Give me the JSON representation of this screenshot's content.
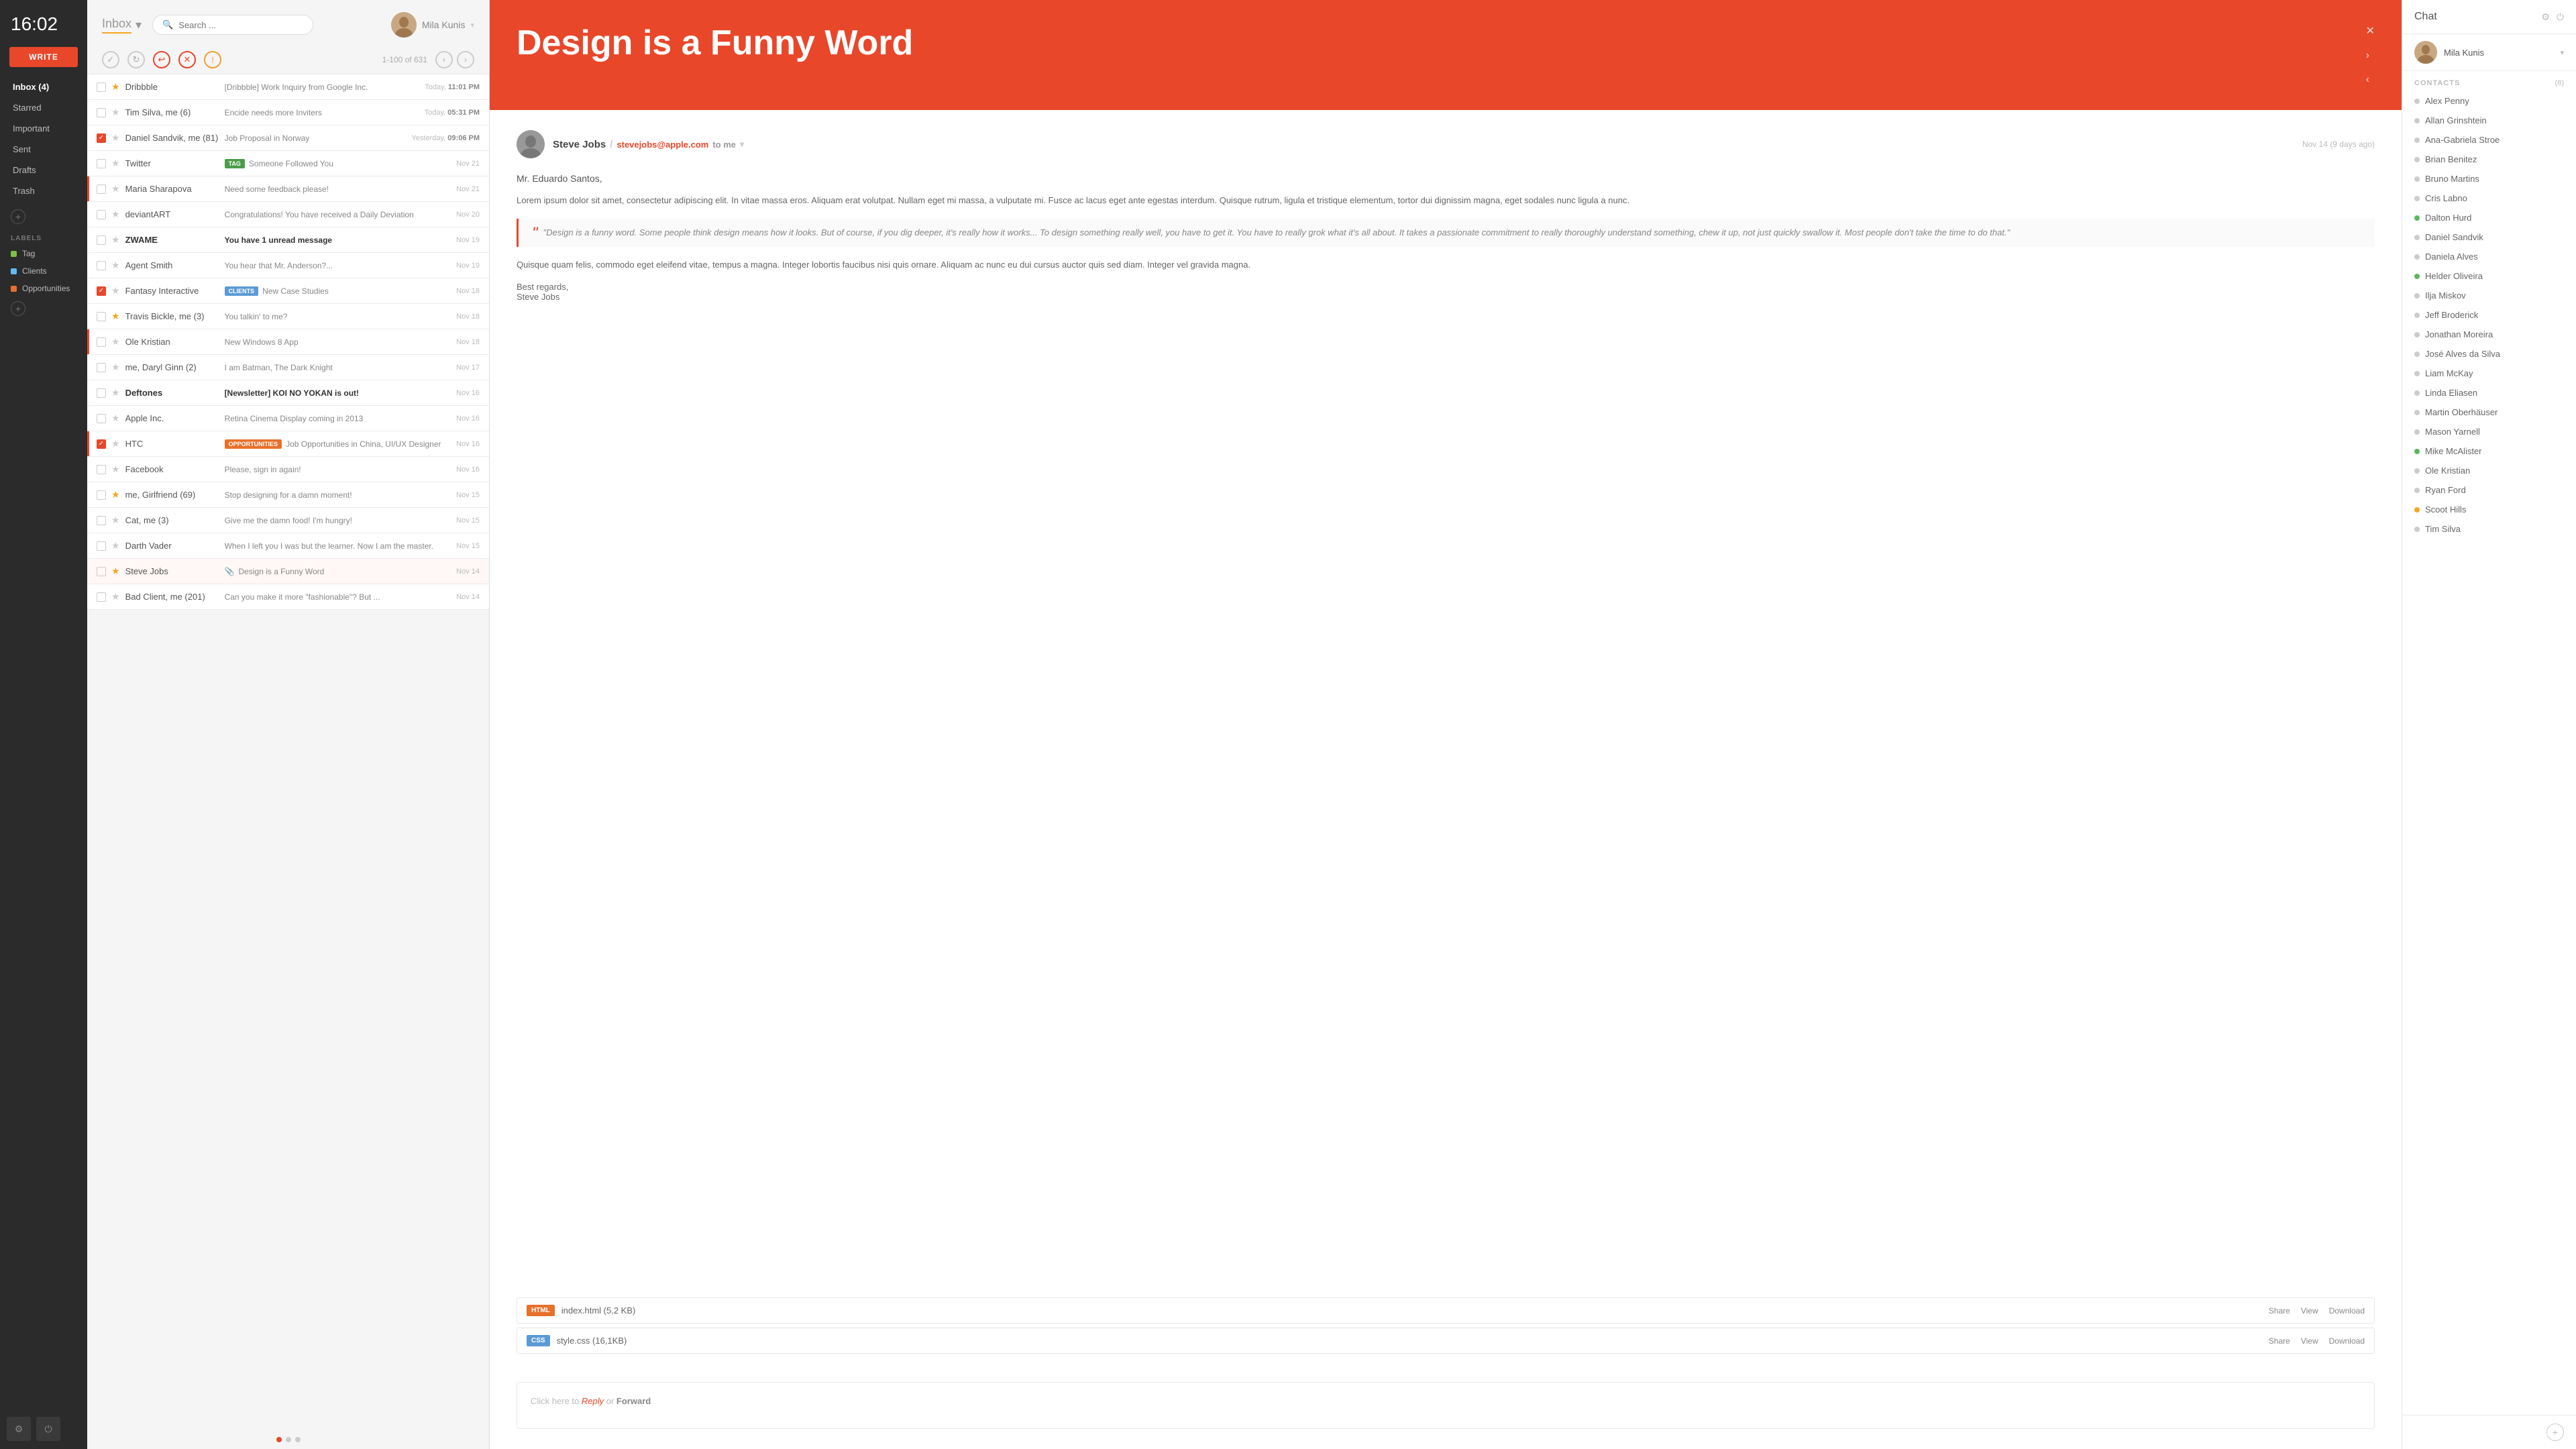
{
  "time": "16:02",
  "write_btn": "WRITE",
  "sidebar": {
    "nav": [
      {
        "id": "inbox",
        "label": "Inbox (4)",
        "active": true
      },
      {
        "id": "starred",
        "label": "Starred"
      },
      {
        "id": "important",
        "label": "Important"
      },
      {
        "id": "sent",
        "label": "Sent"
      },
      {
        "id": "drafts",
        "label": "Drafts"
      },
      {
        "id": "trash",
        "label": "Trash"
      }
    ],
    "labels_header": "LABELS",
    "labels": [
      {
        "id": "tag",
        "label": "Tag",
        "color": "#7dc242"
      },
      {
        "id": "clients",
        "label": "Clients",
        "color": "#5bbcf8"
      },
      {
        "id": "opportunities",
        "label": "Opportunities",
        "color": "#e8702a"
      }
    ]
  },
  "inbox": {
    "title": "Inbox",
    "dropdown_icon": "▾",
    "search_placeholder": "Search ...",
    "user_name": "Mila Kunis",
    "page_info": "1-100 of 631"
  },
  "emails": [
    {
      "id": 1,
      "sender": "Dribbble",
      "subject": "[Dribbble] Work Inquiry from Google Inc.",
      "date": "Today,",
      "time": "11:01 PM",
      "starred": true,
      "unread": false,
      "checked": false,
      "urgent": false,
      "tag": null
    },
    {
      "id": 2,
      "sender": "Tim Silva, me (6)",
      "subject": "Encide needs more Inviters",
      "date": "Today,",
      "time": "05:31 PM",
      "starred": false,
      "unread": false,
      "checked": false,
      "urgent": false,
      "tag": null
    },
    {
      "id": 3,
      "sender": "Daniel Sandvik, me (81)",
      "subject": "Job Proposal in Norway",
      "date": "Yesterday,",
      "time": "09:06 PM",
      "starred": false,
      "unread": false,
      "checked": true,
      "urgent": false,
      "tag": null
    },
    {
      "id": 4,
      "sender": "Twitter",
      "subject": "Someone Followed You",
      "date": "Nov 21",
      "time": "",
      "starred": false,
      "unread": false,
      "checked": false,
      "urgent": false,
      "tag": "TAG"
    },
    {
      "id": 5,
      "sender": "Maria Sharapova",
      "subject": "Need some feedback please!",
      "date": "Nov 21",
      "time": "",
      "starred": false,
      "unread": false,
      "checked": false,
      "urgent": true,
      "tag": null
    },
    {
      "id": 6,
      "sender": "deviantART",
      "subject": "Congratulations! You have received a Daily Deviation",
      "date": "Nov 20",
      "time": "",
      "starred": false,
      "unread": false,
      "checked": false,
      "urgent": false,
      "tag": null
    },
    {
      "id": 7,
      "sender": "ZWAME",
      "subject": "You have 1 unread message",
      "date": "Nov 19",
      "time": "",
      "starred": false,
      "unread": true,
      "checked": false,
      "urgent": false,
      "tag": null
    },
    {
      "id": 8,
      "sender": "Agent Smith",
      "subject": "You hear that Mr. Anderson?...",
      "date": "Nov 19",
      "time": "",
      "starred": false,
      "unread": false,
      "checked": false,
      "urgent": false,
      "tag": null
    },
    {
      "id": 9,
      "sender": "Fantasy Interactive",
      "subject": "New Case Studies",
      "date": "Nov 18",
      "time": "",
      "starred": false,
      "unread": false,
      "checked": true,
      "urgent": false,
      "tag": "CLIENTS"
    },
    {
      "id": 10,
      "sender": "Travis Bickle, me (3)",
      "subject": "You talkin' to me?",
      "date": "Nov 18",
      "time": "",
      "starred": true,
      "unread": false,
      "checked": false,
      "urgent": false,
      "tag": null
    },
    {
      "id": 11,
      "sender": "Ole Kristian",
      "subject": "New Windows 8 App",
      "date": "Nov 18",
      "time": "",
      "starred": false,
      "unread": false,
      "checked": false,
      "urgent": true,
      "tag": null
    },
    {
      "id": 12,
      "sender": "me, Daryl Ginn (2)",
      "subject": "I am Batman, The Dark Knight",
      "date": "Nov 17",
      "time": "",
      "starred": false,
      "unread": false,
      "checked": false,
      "urgent": false,
      "tag": null
    },
    {
      "id": 13,
      "sender": "Deftones",
      "subject": "[Newsletter] KOI NO YOKAN is out!",
      "date": "Nov 16",
      "time": "",
      "starred": false,
      "unread": true,
      "checked": false,
      "urgent": false,
      "tag": null
    },
    {
      "id": 14,
      "sender": "Apple Inc.",
      "subject": "Retina Cinema Display coming in 2013",
      "date": "Nov 16",
      "time": "",
      "starred": false,
      "unread": false,
      "checked": false,
      "urgent": false,
      "tag": null
    },
    {
      "id": 15,
      "sender": "HTC",
      "subject": "Job Opportunities in China, UI/UX Designer",
      "date": "Nov 16",
      "time": "",
      "starred": false,
      "unread": false,
      "checked": true,
      "urgent": true,
      "tag": "OPPORTUNITIES"
    },
    {
      "id": 16,
      "sender": "Facebook",
      "subject": "Please, sign in again!",
      "date": "Nov 16",
      "time": "",
      "starred": false,
      "unread": false,
      "checked": false,
      "urgent": false,
      "tag": null
    },
    {
      "id": 17,
      "sender": "me, Girlfriend (69)",
      "subject": "Stop designing for a damn moment!",
      "date": "Nov 15",
      "time": "",
      "starred": true,
      "unread": false,
      "checked": false,
      "urgent": false,
      "tag": null
    },
    {
      "id": 18,
      "sender": "Cat, me (3)",
      "subject": "Give me the damn food! I'm hungry!",
      "date": "Nov 15",
      "time": "",
      "starred": false,
      "unread": false,
      "checked": false,
      "urgent": false,
      "tag": null
    },
    {
      "id": 19,
      "sender": "Darth Vader",
      "subject": "When I left you I was but the learner. Now I am the master.",
      "date": "Nov 15",
      "time": "",
      "starred": false,
      "unread": false,
      "checked": false,
      "urgent": false,
      "tag": null
    },
    {
      "id": 20,
      "sender": "Steve Jobs",
      "subject": "Design is a Funny Word",
      "date": "Nov 14",
      "time": "",
      "starred": true,
      "unread": false,
      "checked": false,
      "urgent": false,
      "tag": null,
      "active": true
    },
    {
      "id": 21,
      "sender": "Bad Client, me (201)",
      "subject": "Can you make it more \"fashionable\"? But ...",
      "date": "Nov 14",
      "time": "",
      "starred": false,
      "unread": false,
      "checked": false,
      "urgent": false,
      "tag": null
    }
  ],
  "email_detail": {
    "hero_title": "Design is a Funny Word",
    "sender_name": "Steve Jobs",
    "sender_email": "stevejobs@apple.com",
    "to_text": "to me",
    "timestamp": "Nov 14 (9 days ago)",
    "greeting": "Mr. Eduardo Santos,",
    "para1": "Lorem ipsum dolor sit amet, consectetur adipiscing elit. In vitae massa eros. Aliquam erat volutpat. Nullam eget mi massa, a vulputate mi. Fusce ac lacus eget ante egestas interdum. Quisque rutrum, ligula et tristique elementum, tortor dui dignissim magna, eget sodales nunc ligula a nunc.",
    "quote": "\"Design is a funny word. Some people think design means how it looks. But of course, if you dig deeper, it's really how it works... To design something really well, you have to get it. You have to really grok what it's all about. It takes a passionate commitment to really thoroughly understand something, chew it up, not just quickly swallow it. Most people don't take the time to do that.\"",
    "para2": "Quisque quam felis, commodo eget eleifend vitae, tempus a magna. Integer lobortis faucibus nisi quis ornare. Aliquam ac nunc eu dui cursus auctor quis sed diam. Integer vel gravida magna.",
    "signature": "Best regards,\nSteve Jobs",
    "attachments": [
      {
        "type": "HTML",
        "name": "index.html",
        "size": "5,2 KB"
      },
      {
        "type": "CSS",
        "name": "style.css",
        "size": "16,1KB"
      }
    ],
    "reply_prompt": "Click here to ",
    "reply_text": "Reply",
    "or_text": " or ",
    "forward_text": "Forward"
  },
  "chat": {
    "title": "Chat",
    "active_user": "Mila Kunis",
    "contacts_label": "CONTACTS",
    "contacts_count": "(8)",
    "contacts": [
      {
        "name": "Alex Penny",
        "status": "offline"
      },
      {
        "name": "Allan Grinshtein",
        "status": "offline"
      },
      {
        "name": "Ana-Gabriela Stroe",
        "status": "offline"
      },
      {
        "name": "Brian Benitez",
        "status": "offline"
      },
      {
        "name": "Bruno Martins",
        "status": "offline"
      },
      {
        "name": "Cris Labno",
        "status": "offline"
      },
      {
        "name": "Dalton Hurd",
        "status": "online"
      },
      {
        "name": "Daniel Sandvik",
        "status": "offline"
      },
      {
        "name": "Daniela Alves",
        "status": "offline"
      },
      {
        "name": "Helder Oliveira",
        "status": "online"
      },
      {
        "name": "Ilja Miskov",
        "status": "offline"
      },
      {
        "name": "Jeff Broderick",
        "status": "offline"
      },
      {
        "name": "Jonathan Moreira",
        "status": "offline"
      },
      {
        "name": "José Alves da Silva",
        "status": "offline"
      },
      {
        "name": "Liam McKay",
        "status": "offline"
      },
      {
        "name": "Linda Eliasen",
        "status": "offline"
      },
      {
        "name": "Martin Oberhäuser",
        "status": "offline"
      },
      {
        "name": "Mason Yarnell",
        "status": "offline"
      },
      {
        "name": "Mike McAlister",
        "status": "online"
      },
      {
        "name": "Ole Kristian",
        "status": "offline"
      },
      {
        "name": "Ryan Ford",
        "status": "offline"
      },
      {
        "name": "Scoot Hills",
        "status": "away"
      },
      {
        "name": "Tim Silva",
        "status": "offline"
      }
    ]
  }
}
